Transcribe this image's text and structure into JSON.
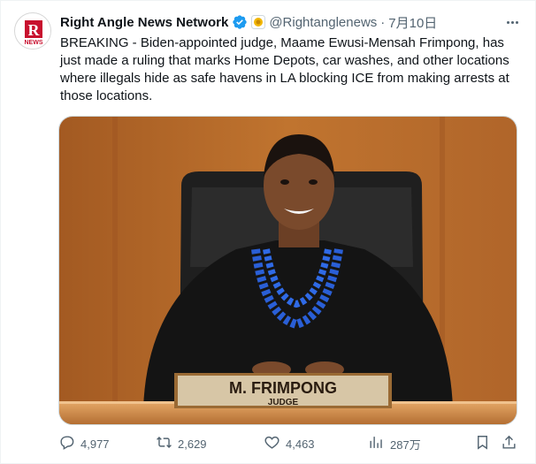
{
  "author": {
    "name": "Right Angle News Network",
    "handle": "@Rightanglenews",
    "date": "7月10日",
    "separator": "·",
    "avatar_letter": "R",
    "avatar_sub": "NEWS"
  },
  "tweet": {
    "text": "BREAKING - Biden-appointed judge, Maame Ewusi-Mensah Frimpong, has just made a ruling that marks Home Depots, car washes, and other locations where illegals hide as safe havens in LA blocking ICE from making arrests at those locations."
  },
  "media": {
    "nameplate_name": "M. FRIMPONG",
    "nameplate_title": "JUDGE"
  },
  "actions": {
    "replies": "4,977",
    "reposts": "2,629",
    "likes": "4,463",
    "views": "287万"
  },
  "colors": {
    "text": "#0f1419",
    "secondary": "#536471",
    "verified": "#1d9bf0",
    "brand_red": "#c8102e"
  },
  "icons": [
    "verified-badge-icon",
    "affiliate-badge-icon",
    "more-icon",
    "reply-icon",
    "repost-icon",
    "like-icon",
    "views-icon",
    "bookmark-icon",
    "share-icon"
  ]
}
